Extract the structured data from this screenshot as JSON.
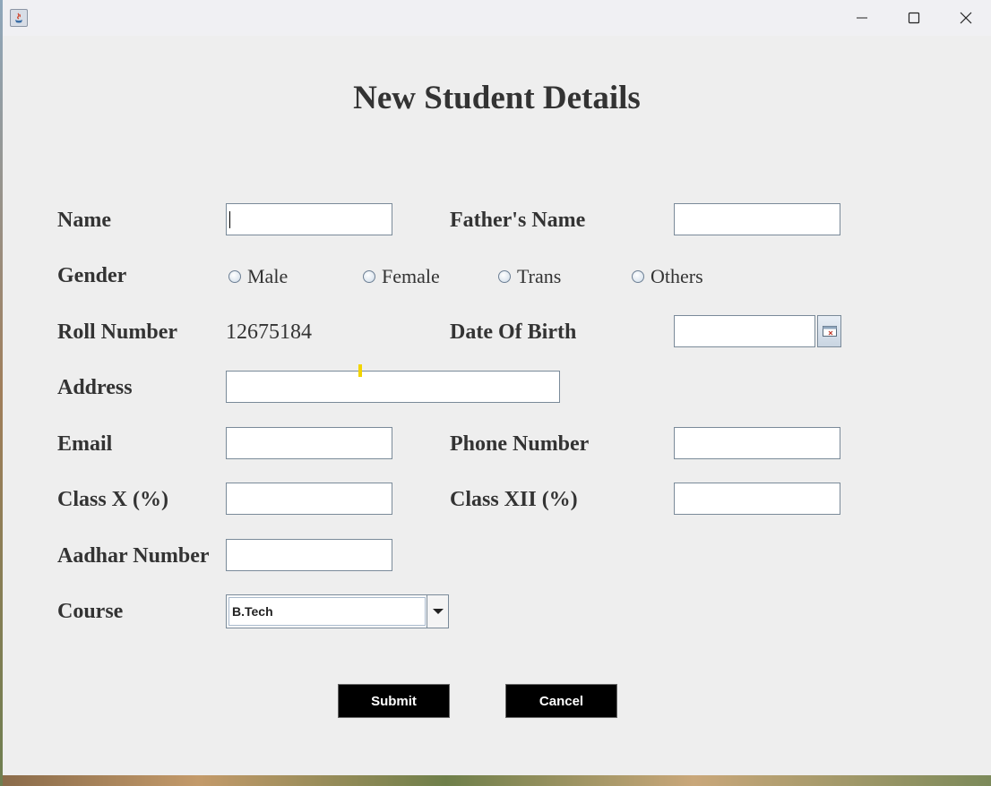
{
  "form": {
    "title": "New Student Details",
    "labels": {
      "name": "Name",
      "fathers_name": "Father's Name",
      "gender": "Gender",
      "roll_number": "Roll Number",
      "date_of_birth": "Date Of Birth",
      "address": "Address",
      "email": "Email",
      "phone_number": "Phone Number",
      "class_x": "Class X (%)",
      "class_xii": "Class XII (%)",
      "aadhar_number": "Aadhar Number",
      "course": "Course"
    },
    "gender_options": [
      "Male",
      "Female",
      "Trans",
      "Others"
    ],
    "roll_number_value": "12675184",
    "fields": {
      "name": "",
      "fathers_name": "",
      "date_of_birth": "",
      "address": "",
      "email": "",
      "phone_number": "",
      "class_x": "",
      "class_xii": "",
      "aadhar_number": ""
    },
    "course_selected": "B.Tech",
    "buttons": {
      "submit": "Submit",
      "cancel": "Cancel"
    }
  },
  "window": {
    "icons": [
      "java-app-icon",
      "minimize-icon",
      "maximize-icon",
      "close-icon"
    ]
  },
  "colors": {
    "window_bg": "#eeeeee",
    "label_text": "#333333",
    "button_bg": "#000000",
    "button_text": "#ffffff"
  }
}
